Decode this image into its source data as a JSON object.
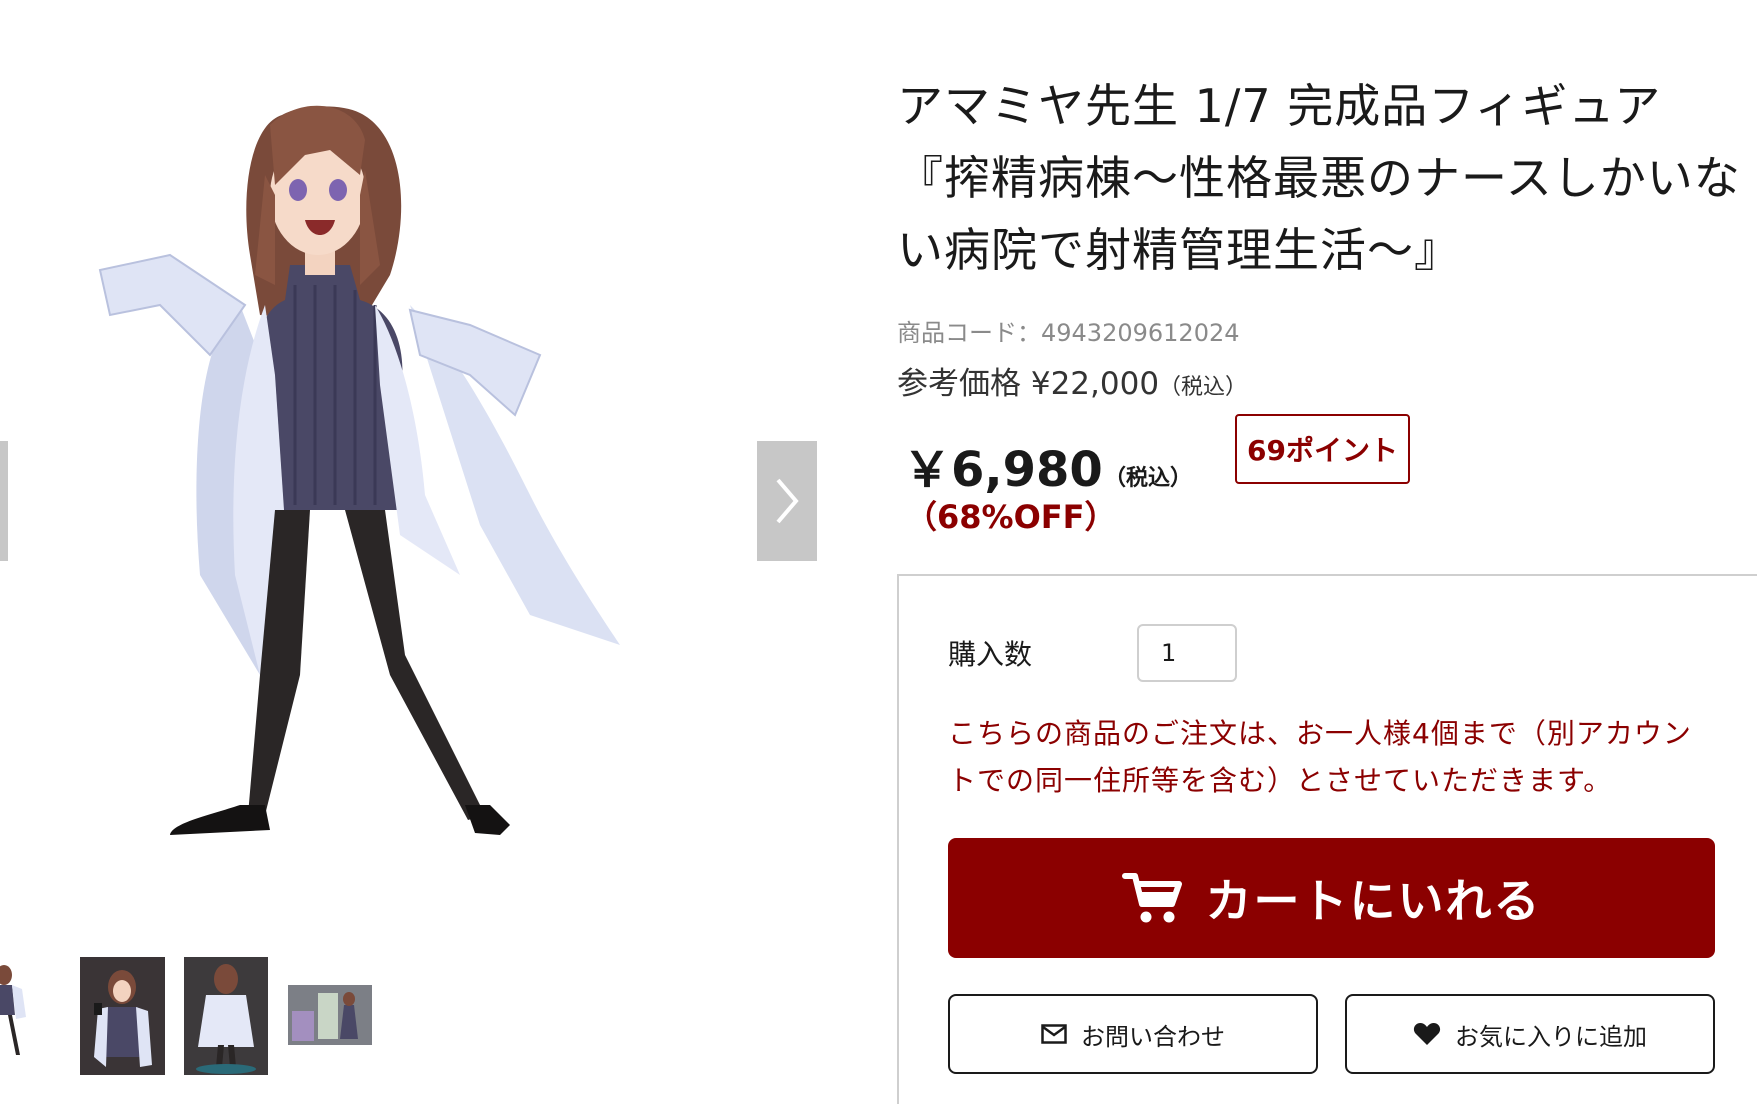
{
  "product": {
    "title": "アマミヤ先生 1/7 完成品フィギュア『搾精病棟〜性格最悪のナースしかいない病院で射精管理生活〜』",
    "code_label": "商品コード：4943209612024",
    "reference_price_label": "参考価格 ¥22,000",
    "reference_price_tax": "（税込）",
    "price": "￥6,980",
    "price_tax": "（税込）",
    "discount": "（68%OFF）",
    "points": "69ポイント"
  },
  "purchase": {
    "quantity_label": "購入数",
    "quantity_value": "1",
    "notice": "こちらの商品のご注文は、お一人様4個まで（別アカウントでの同一住所等を含む）とさせていただきます。",
    "cart_button_label": "カートにいれる",
    "inquiry_button_label": "お問い合わせ",
    "favorite_button_label": "お気に入りに追加"
  },
  "gallery": {
    "thumbnail_count": 4
  },
  "colors": {
    "accent": "#8b0000",
    "text": "#1a1a1a",
    "muted": "#8a8a8a",
    "border": "#cfcfcf",
    "nav": "#c7c7c7"
  },
  "icons": {
    "cart": "cart-icon",
    "inquiry": "mail-icon",
    "favorite": "heart-icon",
    "next": "chevron-right-icon"
  }
}
